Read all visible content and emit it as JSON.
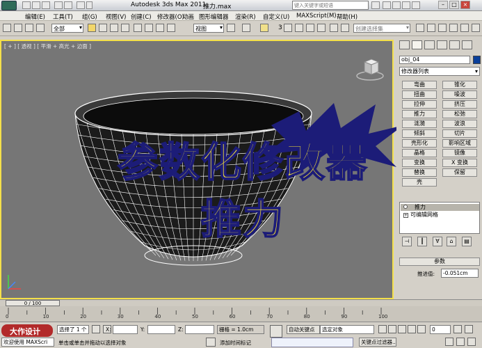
{
  "titlebar": {
    "app_title": "Autodesk 3ds Max  2011",
    "file_title": "推力.max",
    "search_placeholder": "键入关键字或短语",
    "minimize": "–",
    "restore": "□",
    "close": "×"
  },
  "menu": [
    "编辑(E)",
    "工具(T)",
    "组(G)",
    "视图(V)",
    "创建(C)",
    "修改器(O)",
    "动画",
    "图形编辑器",
    "渲染(R)",
    "自定义(U)",
    "MAXScript(M)",
    "帮助(H)"
  ],
  "toolbar": {
    "selection_filter": "全部",
    "ref_coord": "视图",
    "snap_number": "3",
    "named_selection": "创建选择集"
  },
  "viewport": {
    "label": "[ + ] [ 透视 ] [ 平滑 + 高光 + 边面 ]",
    "overlay_line1": "参数化修改器",
    "overlay_line2": "推力",
    "mesh_color": "#1b1b1b",
    "wire_color": "#ffffff"
  },
  "command_panel": {
    "object_name": "obj_04",
    "object_color": "#0a3f9a",
    "modifier_list": "修改器列表",
    "modifier_buttons": [
      [
        "弯曲",
        "锥化"
      ],
      [
        "扭曲",
        "噪波"
      ],
      [
        "拉伸",
        "挤压"
      ],
      [
        "推力",
        "松弛"
      ],
      [
        "涟漪",
        "波浪"
      ],
      [
        "倾斜",
        "切片"
      ],
      [
        "壳形化",
        "影响区域"
      ],
      [
        "晶格",
        "镜像"
      ],
      [
        "变换",
        "X 变换"
      ],
      [
        "替换",
        "保留"
      ],
      [
        "壳",
        ""
      ]
    ],
    "stack": {
      "active_modifier": "推力",
      "base_object": "可编辑网格"
    },
    "params_title": "参数",
    "push_label": "推进值:",
    "push_value": "-0.051cm"
  },
  "timeline": {
    "slider_label": "0 / 100",
    "ticks": [
      "0",
      "10",
      "20",
      "30",
      "40",
      "50",
      "60",
      "70",
      "80",
      "90",
      "100"
    ]
  },
  "status": {
    "selection_info": "选择了 1 个",
    "lock_icon": "lock",
    "x_label": "X:",
    "y_label": "Y:",
    "z_label": "Z:",
    "grid": "栅格 = 1.0cm",
    "prompt": "单击或单击并拖动以选择对象",
    "add_time_tag": "添加时间标记",
    "auto_key": "自动关键点",
    "set_key_dropdown": "选定对象",
    "key_filters": "关键点过滤器...",
    "frame_value": "0",
    "welcome": "欢迎使用 MAXScri",
    "watermark": "大作设计"
  }
}
